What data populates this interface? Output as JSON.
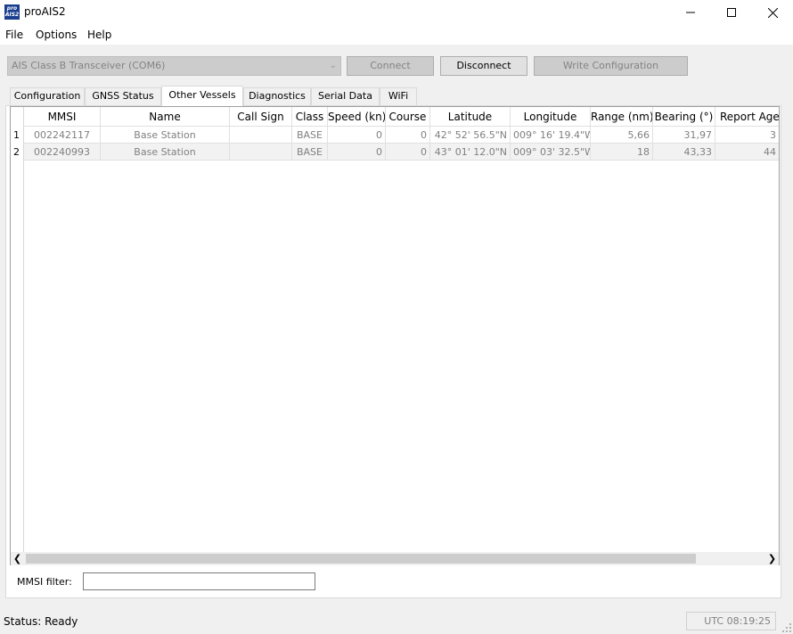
{
  "window": {
    "title": "proAIS2",
    "icon_text": "pro AIS2"
  },
  "menu": {
    "items": [
      "File",
      "Options",
      "Help"
    ]
  },
  "toolbar": {
    "device_select": "AIS Class B Transceiver (COM6)",
    "connect_label": "Connect",
    "disconnect_label": "Disconnect",
    "write_config_label": "Write Configuration"
  },
  "tabs": [
    "Configuration",
    "GNSS Status",
    "Other Vessels",
    "Diagnostics",
    "Serial Data",
    "WiFi"
  ],
  "active_tab": "Other Vessels",
  "table": {
    "columns": [
      "MMSI",
      "Name",
      "Call Sign",
      "Class",
      "Speed (kn)",
      "Course",
      "Latitude",
      "Longitude",
      "Range (nm)",
      "Bearing (°)",
      "Report Age (s)"
    ],
    "rows": [
      {
        "num": "1",
        "cells": [
          "002242117",
          "Base Station",
          "",
          "BASE",
          "0",
          "0",
          "42° 52' 56.5\"N",
          "009° 16' 19.4\"W",
          "5,66",
          "31,97",
          "3"
        ]
      },
      {
        "num": "2",
        "cells": [
          "002240993",
          "Base Station",
          "",
          "BASE",
          "0",
          "0",
          "43° 01' 12.0\"N",
          "009° 03' 32.5\"W",
          "18",
          "43,33",
          "44"
        ]
      }
    ]
  },
  "filter": {
    "label": "MMSI filter:",
    "value": ""
  },
  "statusbar": {
    "status": "Status: Ready",
    "utc": "UTC  08:19:25"
  },
  "colors": {
    "accent": "#1b3f8f",
    "window_bg": "#f0f0f0",
    "disabled_text": "#838383"
  }
}
